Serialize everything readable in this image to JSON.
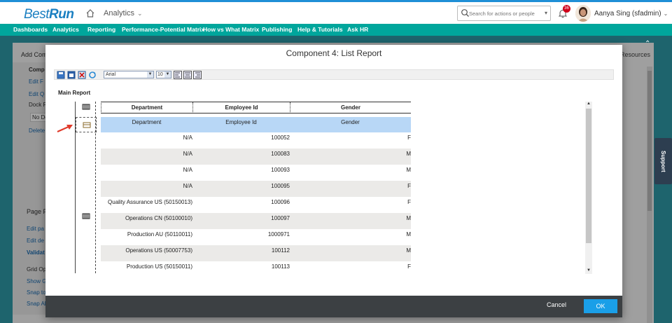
{
  "header": {
    "logo_part1": "Best",
    "logo_part2": "Run",
    "module": "Analytics",
    "search_placeholder": "Search for actions or people",
    "notifications_count": "36",
    "user": "Aanya Sing (sfadmin)"
  },
  "nav": {
    "items": [
      "Dashboards",
      "Analytics",
      "Reporting",
      "Performance-Potential Matrix",
      "How vs What Matrix",
      "Publishing",
      "Help & Tutorials",
      "Ask HR"
    ]
  },
  "background": {
    "add_comp": "Add Comp",
    "comp": "Comp",
    "edit_f": "Edit F",
    "edit_q": "Edit Q",
    "dock_r": "Dock R",
    "no_do": "No Do",
    "delete": "Delete",
    "page_p": "Page P",
    "edit_pa": "Edit pa",
    "edit_de": "Edit de",
    "validat": "Validat",
    "grid_op": "Grid Op",
    "show_g": "Show G",
    "snap_to": "Snap to",
    "snap_al": "Snap Al",
    "resources": "Resources",
    "support": "Support"
  },
  "dialog": {
    "title": "Component 4: List Report",
    "font_name": "Arial",
    "font_size": "10",
    "section_label": "Main Report",
    "columns": [
      "Department",
      "Employee Id",
      "Gender"
    ],
    "detail_header": [
      "Department",
      "Employee Id",
      "Gender"
    ],
    "rows": [
      {
        "dept": "N/A",
        "id": "100052",
        "gender": "F"
      },
      {
        "dept": "N/A",
        "id": "100083",
        "gender": "M"
      },
      {
        "dept": "N/A",
        "id": "100093",
        "gender": "M"
      },
      {
        "dept": "N/A",
        "id": "100095",
        "gender": "F"
      },
      {
        "dept": "Quality Assurance US (50150013)",
        "id": "100096",
        "gender": "F"
      },
      {
        "dept": "Operations CN (50100010)",
        "id": "100097",
        "gender": "M"
      },
      {
        "dept": "Production AU (50110011)",
        "id": "1000971",
        "gender": "M"
      },
      {
        "dept": "Operations US (50007753)",
        "id": "100112",
        "gender": "M"
      },
      {
        "dept": "Production US (50150011)",
        "id": "100113",
        "gender": "F"
      }
    ],
    "cancel_label": "Cancel",
    "ok_label": "OK"
  },
  "colors": {
    "nav": "#00a69c",
    "accent": "#1a9fe8",
    "selection": "#b8d7f6"
  }
}
